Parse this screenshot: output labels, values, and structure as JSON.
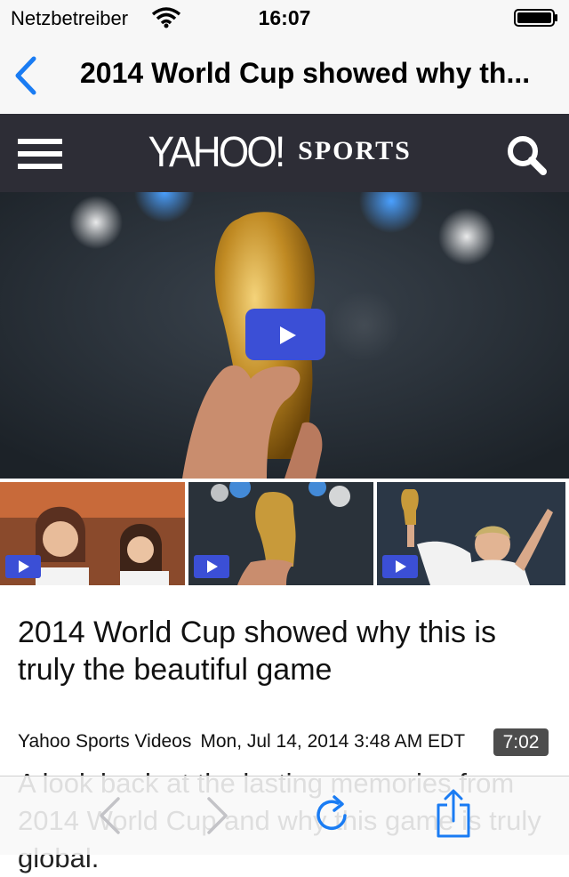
{
  "status_bar": {
    "carrier": "Netzbetreiber",
    "time": "16:07"
  },
  "nav": {
    "title": "2014 World Cup showed why th..."
  },
  "brand": {
    "logo_text": "YAHOO!",
    "section_text": "SPORTS"
  },
  "article": {
    "headline": "2014 World Cup showed why this is truly the beautiful game",
    "source": "Yahoo Sports Videos",
    "date": "Mon, Jul 14, 2014 3:48 AM EDT",
    "duration": "7:02",
    "description": "A look back at the lasting memories from 2014 World Cup and why this game is truly global."
  },
  "icons": {
    "back": "chevron-left-icon",
    "menu": "hamburger-icon",
    "search": "search-icon",
    "play": "play-icon",
    "toolbar": [
      "chevron-left-icon",
      "chevron-right-icon",
      "refresh-icon",
      "share-icon"
    ]
  },
  "colors": {
    "accent": "#1a7cf3",
    "header_bg": "#2d2d36",
    "play_button": "#3b4fd6",
    "duration_badge": "#4d4d4d"
  }
}
